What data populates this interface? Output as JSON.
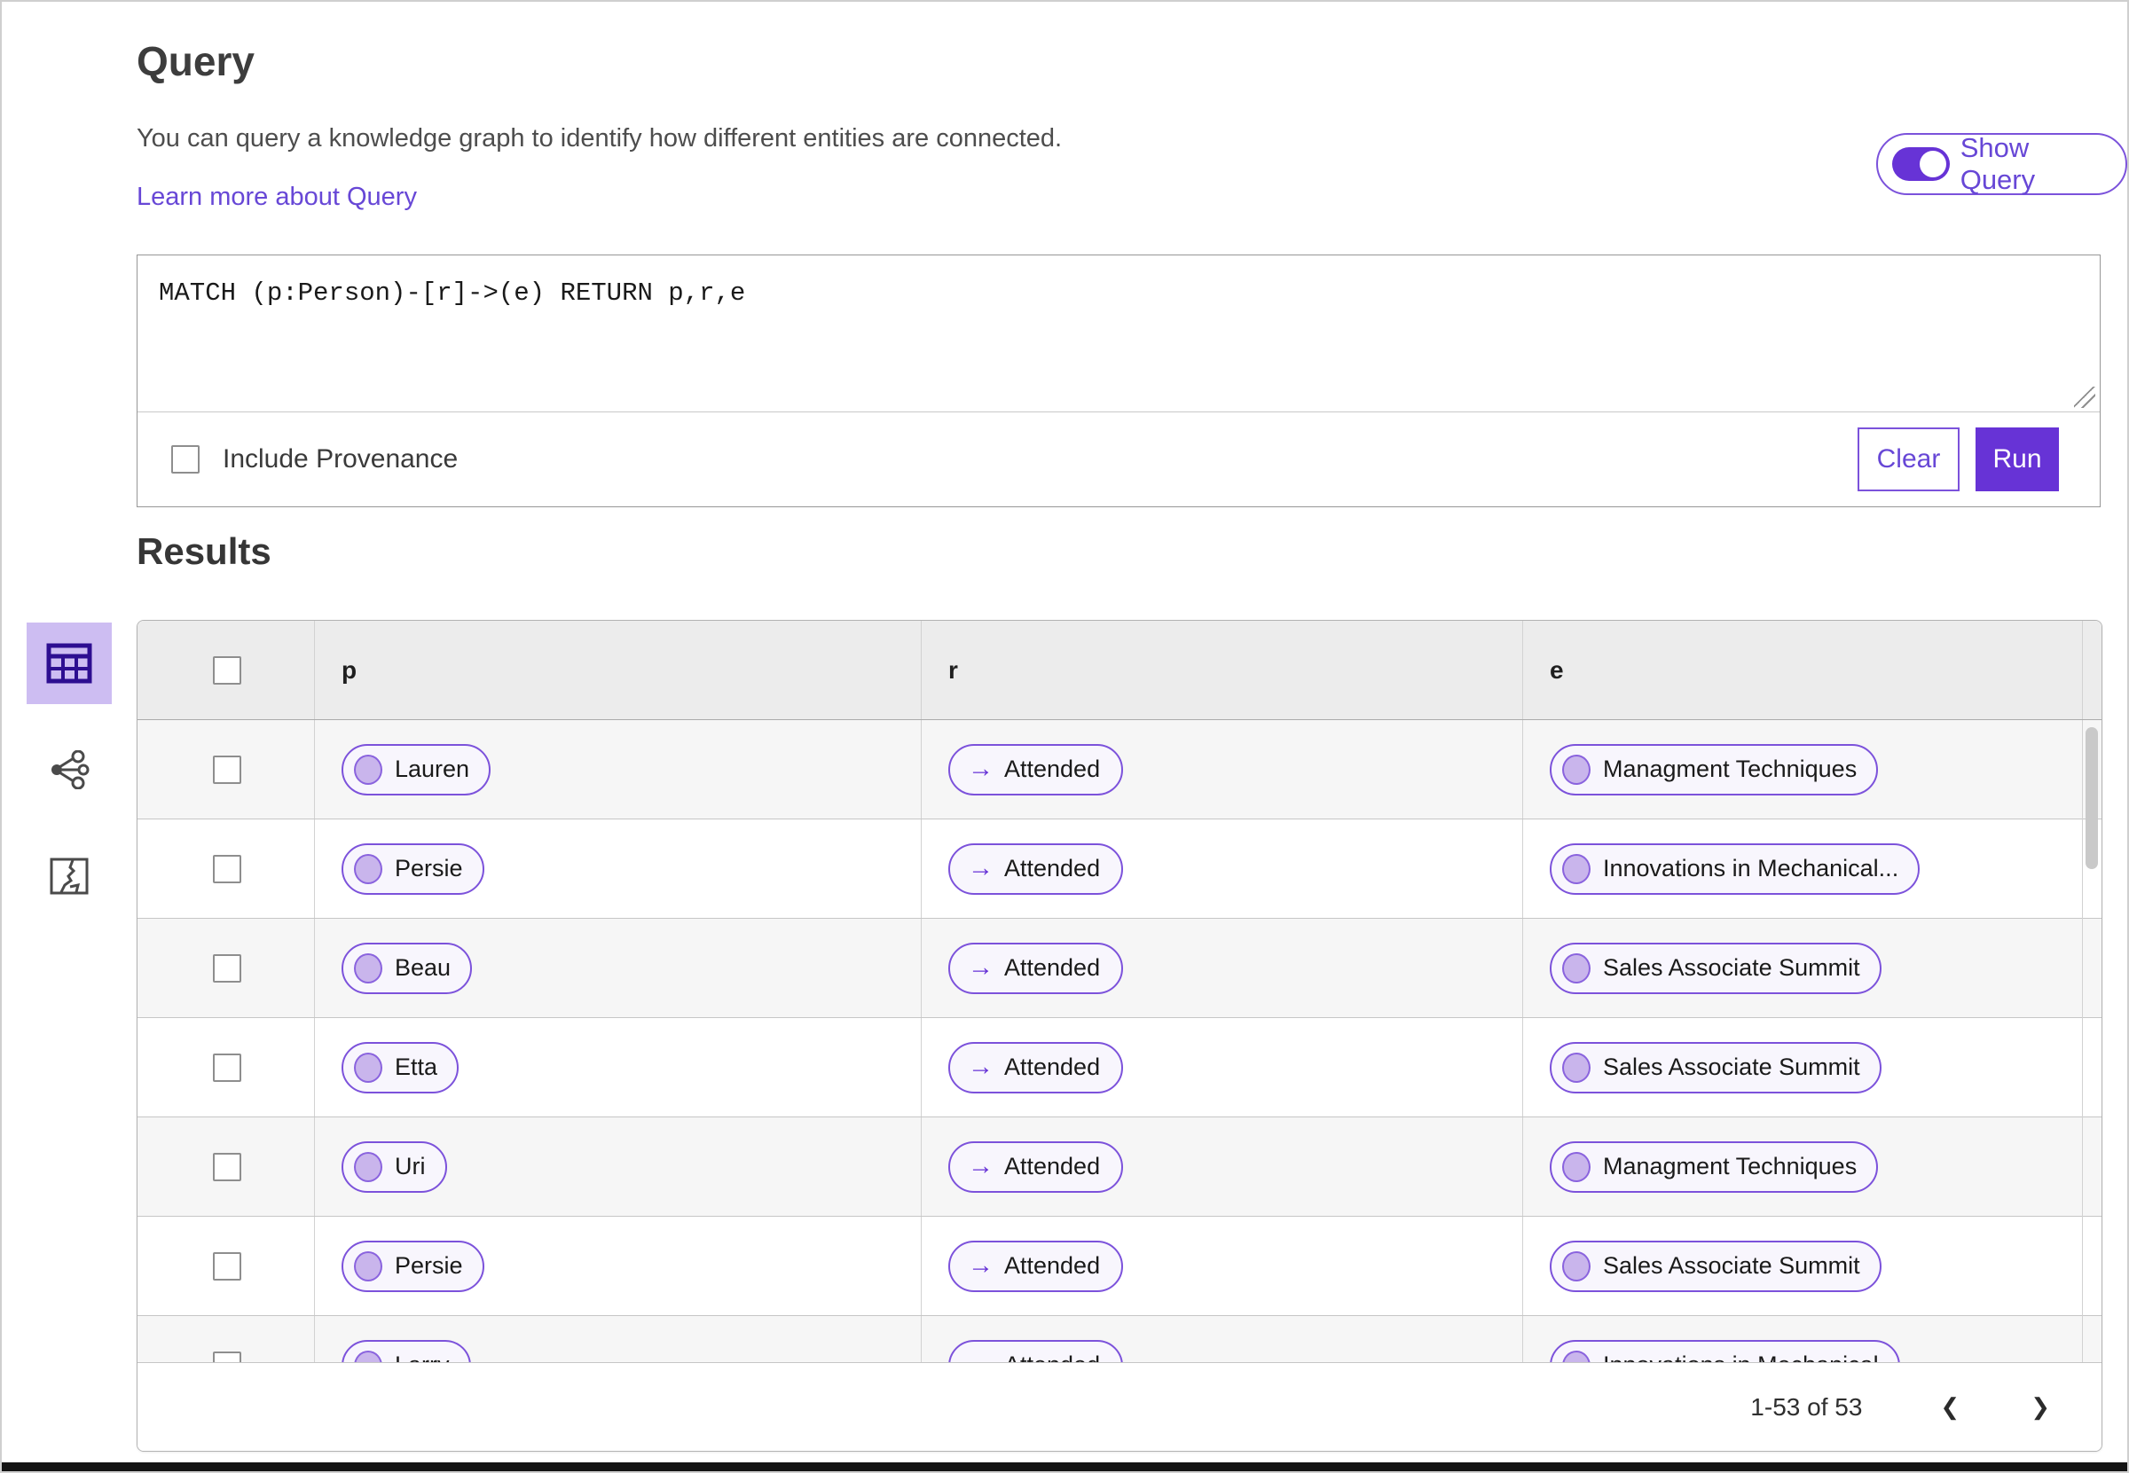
{
  "header": {
    "title": "Query",
    "description": "You can query a knowledge graph to identify how different entities are connected.",
    "learn_more_link": "Learn more about Query",
    "show_query_label": "Show Query",
    "show_query_state": "on"
  },
  "query_panel": {
    "query_text": "MATCH (p:Person)-[r]->(e) RETURN p,r,e",
    "include_provenance_label": "Include Provenance",
    "include_provenance_checked": false,
    "clear_label": "Clear",
    "run_label": "Run"
  },
  "results": {
    "title": "Results",
    "view_toolbar": [
      {
        "name": "table-view",
        "selected": true
      },
      {
        "name": "graph-view",
        "selected": false
      },
      {
        "name": "map-view",
        "selected": false
      }
    ],
    "table": {
      "columns": [
        "p",
        "r",
        "e"
      ],
      "rows": [
        {
          "p": "Lauren",
          "r": "Attended",
          "e": "Managment Techniques"
        },
        {
          "p": "Persie",
          "r": "Attended",
          "e": "Innovations in Mechanical..."
        },
        {
          "p": "Beau",
          "r": "Attended",
          "e": "Sales Associate Summit"
        },
        {
          "p": "Etta",
          "r": "Attended",
          "e": "Sales Associate Summit"
        },
        {
          "p": "Uri",
          "r": "Attended",
          "e": "Managment Techniques"
        },
        {
          "p": "Persie",
          "r": "Attended",
          "e": "Sales Associate Summit"
        },
        {
          "p": "Larry",
          "r": "Attended",
          "e": "Innovations in Mechanical"
        }
      ],
      "pagination": {
        "range_label": "1-53 of 53"
      }
    }
  },
  "icons": {
    "arrow_right": "→",
    "chevron_left": "❮",
    "chevron_right": "❯"
  },
  "colors": {
    "accent": "#6733d6",
    "accent_border": "#7b52db",
    "selected_tile_bg": "#cdbdf2",
    "pill_bg": "#f8f6fd",
    "node_dot_fill": "#c9b5ec",
    "header_row_bg": "#ececec",
    "alt_row_bg": "#f6f6f6"
  }
}
